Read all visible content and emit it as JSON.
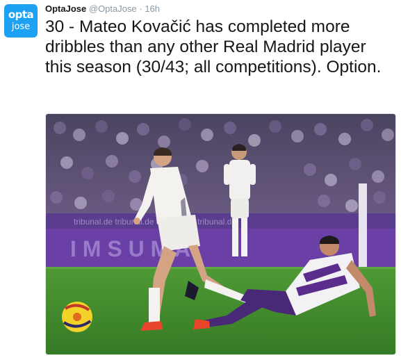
{
  "tweet": {
    "avatar": {
      "line1": "opta",
      "line2": "jose"
    },
    "display_name": "OptaJose",
    "handle": "@OptaJose",
    "separator": "·",
    "time": "16h",
    "text": "30 - Mateo Kovačić has completed more dribbles than any other Real Madrid player this season (30/43; all competitions). Option.",
    "media": {
      "description_icon": "football-photo",
      "ad_boards": {
        "upper": "tribunal.de",
        "lower": "I M     S U M A"
      }
    }
  },
  "colors": {
    "brand": "#1da1f2",
    "text": "#14171a",
    "muted": "#8899a6",
    "pitch": "#3f8a2e",
    "away_kit": "#5a2d8c"
  }
}
